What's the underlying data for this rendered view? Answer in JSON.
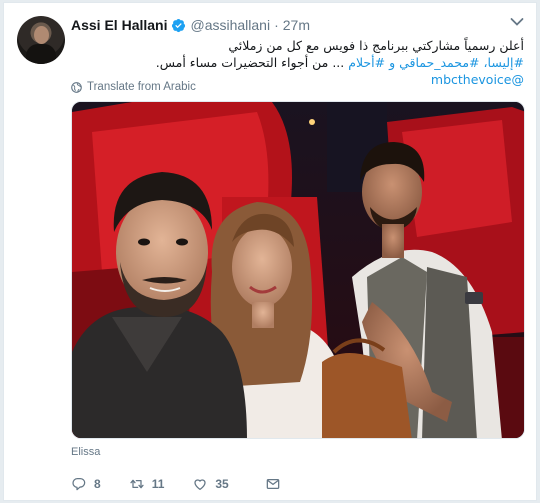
{
  "tweet": {
    "author": {
      "name": "Assi El Hallani",
      "handle": "@assihallani",
      "verified": true
    },
    "separator": "·",
    "time": "27m",
    "text": {
      "line1": "أعلن رسمياً مشاركتي ببرنامج ذا فويس مع كل من زملائي",
      "line2_hashtags": "#إليسا، #محمد_حماقي و #أحلام",
      "line2_rest": " ... من أجواء التحضيرات مساء أمس.",
      "line3_mention": "@mbcthevoice"
    },
    "translate_label": "Translate from Arabic",
    "media_caption": "Elissa",
    "actions": {
      "replies": "8",
      "retweets": "11",
      "likes": "35"
    }
  },
  "colors": {
    "link": "#1b95e0",
    "muted": "#657786",
    "verified": "#1da1f2",
    "chair_red": "#c4141c"
  },
  "icons": [
    "verified-badge-icon",
    "chevron-down-icon",
    "globe-icon",
    "reply-icon",
    "retweet-icon",
    "like-icon",
    "direct-message-icon"
  ]
}
